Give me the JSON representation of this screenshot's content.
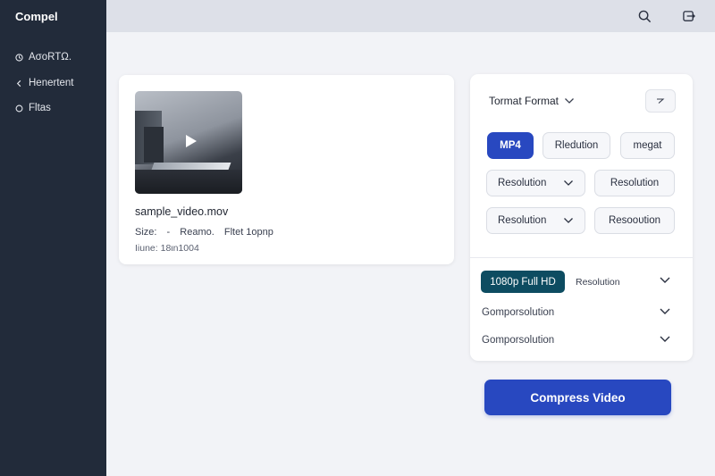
{
  "sidebar": {
    "brand": "Compel",
    "items": [
      {
        "label": "AσoRTΩ.",
        "icon": "clock-icon"
      },
      {
        "label": "Henertent",
        "icon": "chevron-left-icon"
      },
      {
        "label": "Fltas",
        "icon": "circle-icon"
      }
    ]
  },
  "header": {
    "icons": [
      "search-icon",
      "export-icon"
    ]
  },
  "file": {
    "name": "sample_video.mov",
    "meta": [
      "Size:",
      "-",
      "Reamo.",
      "Fltet 1opnp"
    ],
    "duration": "Iiune: 18ιn1004"
  },
  "panel": {
    "title": "Tormat Format",
    "format_chips": [
      {
        "label": "MP4",
        "active": true
      },
      {
        "label": "Rledution",
        "active": false
      },
      {
        "label": "megat",
        "active": false
      }
    ],
    "selects": [
      {
        "label": "Resolution"
      },
      {
        "label": "Resolution"
      },
      {
        "label": "Resolution"
      },
      {
        "label": "Resoουtion"
      }
    ],
    "resolution_value": "1080p Full HD",
    "resolution_label": "Resolution",
    "rows": [
      {
        "label": "Gomporsolution"
      },
      {
        "label": "Gomporsolution"
      }
    ]
  },
  "action": {
    "compress_label": "Compress Video"
  },
  "colors": {
    "sidebar": "#222b3a",
    "accent": "#2848c0",
    "teal": "#0d4c61"
  }
}
